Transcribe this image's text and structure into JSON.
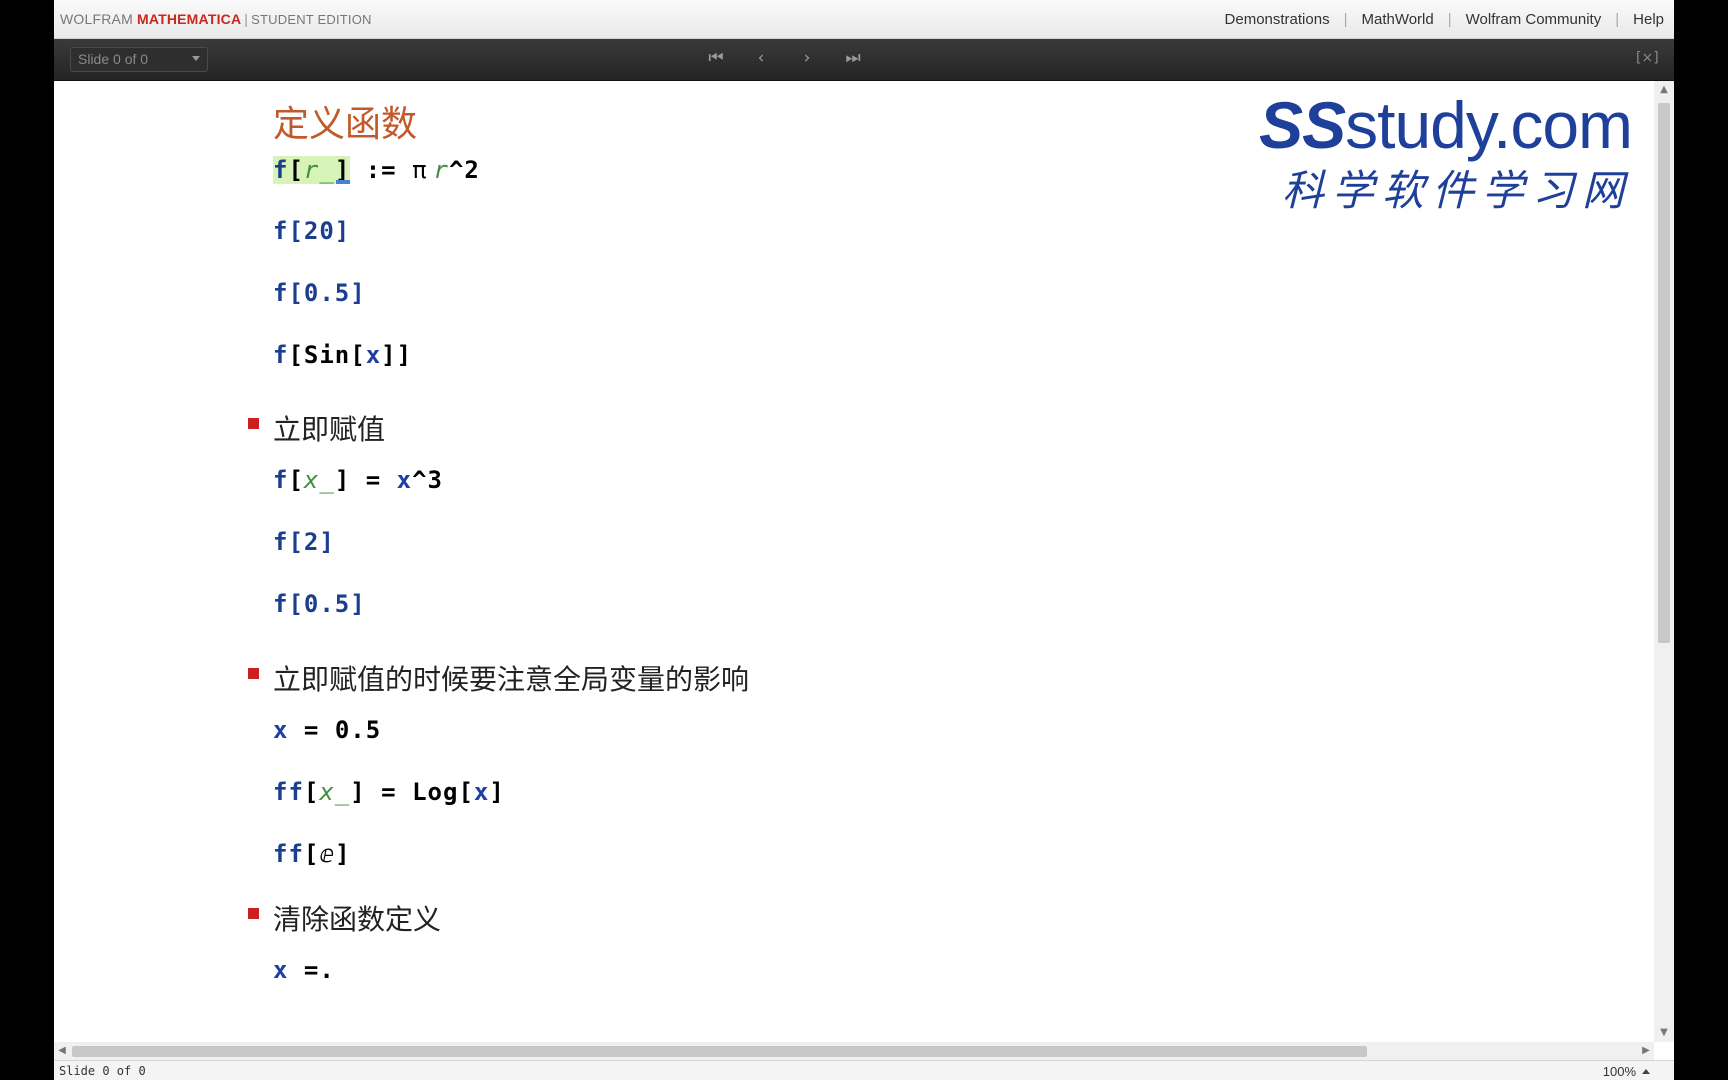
{
  "header": {
    "brand_wolfram": "WOLFRAM",
    "brand_mathematica": "MATHEMATICA",
    "brand_separator": "|",
    "brand_edition": "STUDENT EDITION",
    "links": [
      "Demonstrations",
      "MathWorld",
      "Wolfram Community",
      "Help"
    ],
    "link_separator": "|"
  },
  "slidebar": {
    "slide_selector": "Slide 0 of 0",
    "first_icon": "⏮",
    "prev_icon": "‹",
    "next_icon": "›",
    "last_icon": "⏭",
    "close_icon": "[×]"
  },
  "watermark": {
    "logo_ss": "SS",
    "logo_rest": "study.com",
    "subtitle": "科学软件学习网"
  },
  "notebook": {
    "title": "定义函数",
    "sections": [
      "立即赋值",
      "立即赋值的时候要注意全局变量的影响",
      "清除函数定义"
    ],
    "cells": {
      "c1": {
        "f": "f",
        "lb": "[",
        "pat": "r_",
        "rb": "]",
        "op": " := ",
        "pi": "π",
        "r": "r",
        "pow": "^2"
      },
      "c2": "f[20]",
      "c3": "f[0.5]",
      "c4": {
        "f": "f",
        "lb": "[",
        "sin": "Sin",
        "lb2": "[",
        "x": "x",
        "rb": "]]"
      },
      "c5": {
        "f": "f",
        "lb": "[",
        "pat": "x_",
        "rb": "]",
        "op": " = ",
        "x": "x",
        "pow": "^3"
      },
      "c6": "f[2]",
      "c7": "f[0.5]",
      "c8": {
        "x": "x",
        "op": " = ",
        "val": "0.5"
      },
      "c9": {
        "f": "ff",
        "lb": "[",
        "pat": "x_",
        "rb": "]",
        "op": " = ",
        "log": "Log",
        "lb2": "[",
        "x": "x",
        "rb2": "]"
      },
      "c10": {
        "f": "ff",
        "lb": "[",
        "e": "ⅇ",
        "rb": "]"
      },
      "c11": {
        "x": "x",
        "op": " =."
      }
    }
  },
  "status": {
    "text": "Slide 0 of 0",
    "zoom": "100%"
  }
}
